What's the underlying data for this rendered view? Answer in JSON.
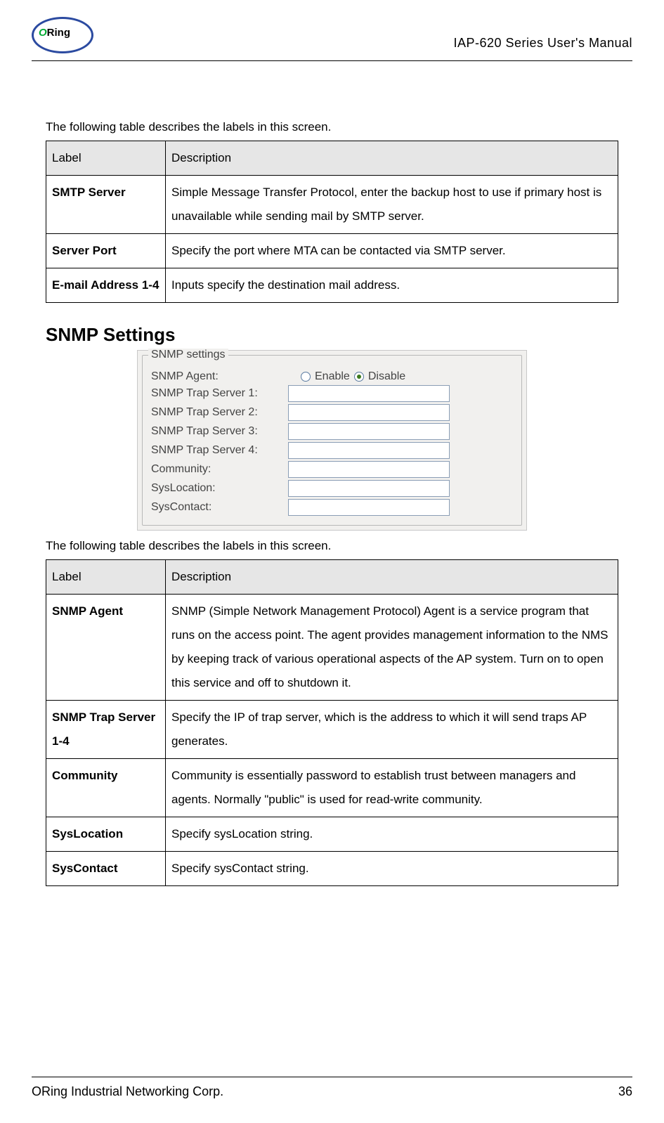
{
  "header": {
    "title": "IAP-620 Series User's Manual",
    "logo_text": "ORing"
  },
  "intro1": "The following table describes the labels in this screen.",
  "table1": {
    "headers": {
      "label": "Label",
      "description": "Description"
    },
    "rows": [
      {
        "label": "SMTP Server",
        "desc": "Simple Message Transfer Protocol, enter the backup host to use if primary host is unavailable while sending mail by SMTP server."
      },
      {
        "label": "Server Port",
        "desc": "Specify the port where MTA can be contacted via SMTP server."
      },
      {
        "label": "E-mail Address 1-4",
        "desc": "Inputs specify the destination mail address."
      }
    ]
  },
  "section_heading": "SNMP Settings",
  "screenshot": {
    "legend": "SNMP settings",
    "agent_label": "SNMP Agent:",
    "enable": "Enable",
    "disable": "Disable",
    "agent_value": "Disable",
    "trap1": "SNMP Trap Server 1:",
    "trap2": "SNMP Trap Server 2:",
    "trap3": "SNMP Trap Server 3:",
    "trap4": "SNMP Trap Server 4:",
    "community": "Community:",
    "syslocation": "SysLocation:",
    "syscontact": "SysContact:"
  },
  "intro2": "The following table describes the labels in this screen.",
  "table2": {
    "headers": {
      "label": "Label",
      "description": "Description"
    },
    "rows": [
      {
        "label": "SNMP Agent",
        "desc": "SNMP (Simple Network Management Protocol) Agent is a service program that runs on the access point.   The agent provides management information to the NMS by keeping track of various operational aspects of the AP system.   Turn on to open this service and off to shutdown it."
      },
      {
        "label": "SNMP Trap Server 1-4",
        "desc": "Specify the IP of trap server, which is the address to which it will send traps AP generates."
      },
      {
        "label": "Community",
        "desc": "Community is essentially password to establish trust between managers and agents. Normally \"public\" is used for read-write community."
      },
      {
        "label": "SysLocation",
        "desc": "Specify sysLocation string."
      },
      {
        "label": "SysContact",
        "desc": "Specify sysContact string."
      }
    ]
  },
  "footer": {
    "company": "ORing Industrial Networking Corp.",
    "page": "36"
  }
}
